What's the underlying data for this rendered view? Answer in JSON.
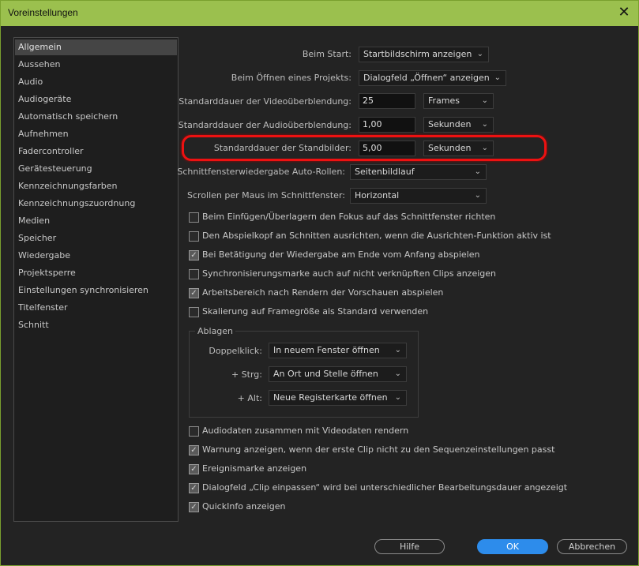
{
  "window": {
    "title": "Voreinstellungen"
  },
  "sidebar": {
    "items": [
      "Allgemein",
      "Aussehen",
      "Audio",
      "Audiogeräte",
      "Automatisch speichern",
      "Aufnehmen",
      "Fadercontroller",
      "Gerätesteuerung",
      "Kennzeichnungsfarben",
      "Kennzeichnungszuordnung",
      "Medien",
      "Speicher",
      "Wiedergabe",
      "Projektsperre",
      "Einstellungen synchronisieren",
      "Titelfenster",
      "Schnitt"
    ],
    "selected": "Allgemein"
  },
  "settings": {
    "beim_start": {
      "label": "Beim Start:",
      "value": "Startbildschirm anzeigen"
    },
    "beim_oeffnen": {
      "label": "Beim Öffnen eines Projekts:",
      "value": "Dialogfeld „Öffnen“ anzeigen"
    },
    "video_ueberblendung": {
      "label": "Standarddauer der Videoüberblendung:",
      "value": "25",
      "unit": "Frames"
    },
    "audio_ueberblendung": {
      "label": "Standarddauer der Audioüberblendung:",
      "value": "1,00",
      "unit": "Sekunden"
    },
    "standbilder": {
      "label": "Standarddauer der Standbilder:",
      "value": "5,00",
      "unit": "Sekunden"
    },
    "auto_rollen": {
      "label": "Schnittfensterwiedergabe Auto-Rollen:",
      "value": "Seitenbildlauf"
    },
    "scrollen": {
      "label": "Scrollen per Maus im Schnittfenster:",
      "value": "Horizontal"
    }
  },
  "checkboxes_top": [
    {
      "label": "Beim Einfügen/Überlagern den Fokus auf das Schnittfenster richten",
      "checked": false
    },
    {
      "label": "Den Abspielkopf an Schnitten ausrichten, wenn die Ausrichten-Funktion aktiv ist",
      "checked": false
    },
    {
      "label": "Bei Betätigung der Wiedergabe am Ende vom Anfang abspielen",
      "checked": true
    },
    {
      "label": "Synchronisierungsmarke auch auf nicht verknüpften Clips anzeigen",
      "checked": false
    },
    {
      "label": "Arbeitsbereich nach Rendern der Vorschauen abspielen",
      "checked": true
    },
    {
      "label": "Skalierung auf Framegröße als Standard verwenden",
      "checked": false
    }
  ],
  "ablagen": {
    "title": "Ablagen",
    "rows": [
      {
        "label": "Doppelklick:",
        "value": "In neuem Fenster öffnen"
      },
      {
        "label": "+ Strg:",
        "value": "An Ort und Stelle öffnen"
      },
      {
        "label": "+ Alt:",
        "value": "Neue Registerkarte öffnen"
      }
    ]
  },
  "checkboxes_bottom": [
    {
      "label": "Audiodaten zusammen mit Videodaten rendern",
      "checked": false
    },
    {
      "label": "Warnung anzeigen, wenn der erste Clip nicht zu den Sequenzeinstellungen passt",
      "checked": true
    },
    {
      "label": "Ereignismarke anzeigen",
      "checked": true
    },
    {
      "label": "Dialogfeld „Clip einpassen“ wird bei unterschiedlicher Bearbeitungsdauer angezeigt",
      "checked": true
    },
    {
      "label": "QuickInfo anzeigen",
      "checked": true
    }
  ],
  "buttons": {
    "help": "Hilfe",
    "ok": "OK",
    "cancel": "Abbrechen"
  },
  "icons": {
    "close": "close-icon",
    "chevron": "chevron-down-icon",
    "check": "checkmark-icon"
  },
  "colors": {
    "titlebar": "#9bc04e",
    "primary": "#2d8ceb",
    "highlight": "#e11111"
  }
}
